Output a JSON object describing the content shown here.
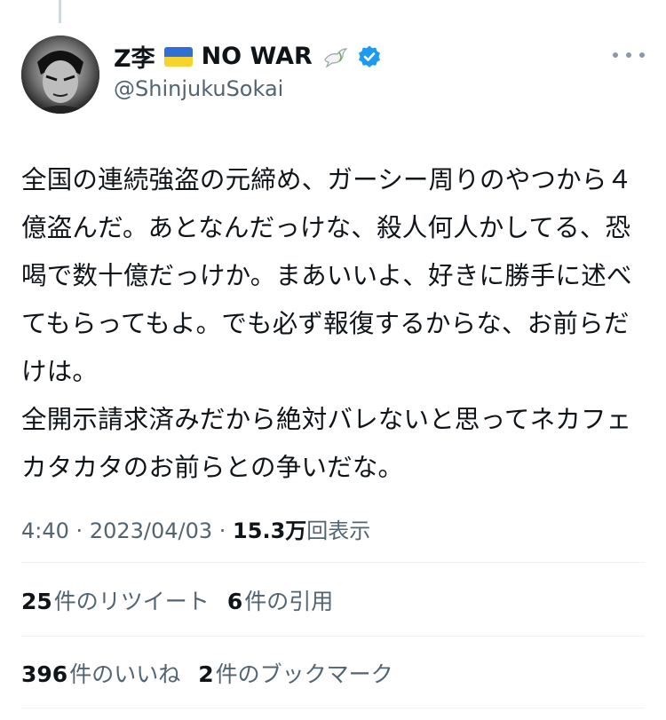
{
  "author": {
    "display_name": "Z李",
    "display_suffix": "NO WAR",
    "handle": "@ShinjukuSokai",
    "verified": true
  },
  "tweet": {
    "text": "全国の連続強盗の元締め、ガーシー周りのやつから４億盗んだ。あとなんだっけな、殺人何人かしてる、恐喝で数十億だっけか。まあいいよ、好きに勝手に述べてもらってもよ。でも必ず報復するからな、お前らだけは。\n全開示請求済みだから絶対バレないと思ってネカフェカタカタのお前らとの争いだな。",
    "time": "4:40",
    "date": "2023/04/03",
    "views_count": "15.3万",
    "views_label": "回表示"
  },
  "stats": {
    "retweets_count": "25",
    "retweets_label": "件のリツイート",
    "quotes_count": "6",
    "quotes_label": "件の引用",
    "likes_count": "396",
    "likes_label": "件のいいね",
    "bookmarks_count": "2",
    "bookmarks_label": "件のブックマーク"
  },
  "icons": {
    "avatar": "avatar-image",
    "flag": "ukraine-flag-icon",
    "dove": "dove-icon",
    "verified": "verified-badge-icon",
    "more": "more-options-icon"
  },
  "colors": {
    "verified": "#1d9bf0",
    "secondary_text": "#536471",
    "primary_text": "#0f1419"
  }
}
